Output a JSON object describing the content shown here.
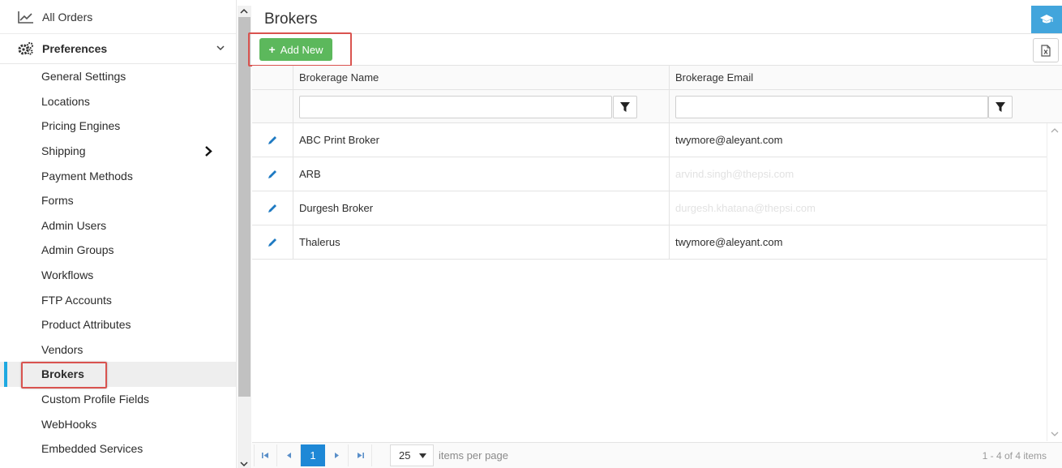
{
  "sidebar": {
    "top_item": {
      "label": "All Orders",
      "icon": "line-chart-icon"
    },
    "section": {
      "label": "Preferences",
      "icon": "gears-icon"
    },
    "items": [
      {
        "label": "General Settings"
      },
      {
        "label": "Locations"
      },
      {
        "label": "Pricing Engines"
      },
      {
        "label": "Shipping",
        "has_submenu": true
      },
      {
        "label": "Payment Methods"
      },
      {
        "label": "Forms"
      },
      {
        "label": "Admin Users"
      },
      {
        "label": "Admin Groups"
      },
      {
        "label": "Workflows"
      },
      {
        "label": "FTP Accounts"
      },
      {
        "label": "Product Attributes"
      },
      {
        "label": "Vendors"
      },
      {
        "label": "Brokers",
        "active": true
      },
      {
        "label": "Custom Profile Fields"
      },
      {
        "label": "WebHooks"
      },
      {
        "label": "Embedded Services"
      }
    ]
  },
  "main": {
    "title": "Brokers",
    "toolbar": {
      "add_label": "Add New"
    },
    "columns": [
      "Brokerage Name",
      "Brokerage Email"
    ],
    "filters": {
      "name_value": "",
      "email_value": ""
    },
    "rows": [
      {
        "name": "ABC Print Broker",
        "email": "twymore@aleyant.com"
      },
      {
        "name": "ARB",
        "email": "arvind.singh@thepsi.com"
      },
      {
        "name": "Durgesh Broker",
        "email": "durgesh.khatana@thepsi.com"
      },
      {
        "name": "Thalerus",
        "email": "twymore@aleyant.com"
      }
    ],
    "pager": {
      "current_page": "1",
      "page_size": "25",
      "per_page_label": "items per page",
      "info": "1 - 4 of 4 items"
    }
  },
  "colors": {
    "accent": "#1e88d6",
    "add_button": "#5cb85c",
    "highlight": "#d9534f",
    "active_marker": "#1ea9e1"
  }
}
